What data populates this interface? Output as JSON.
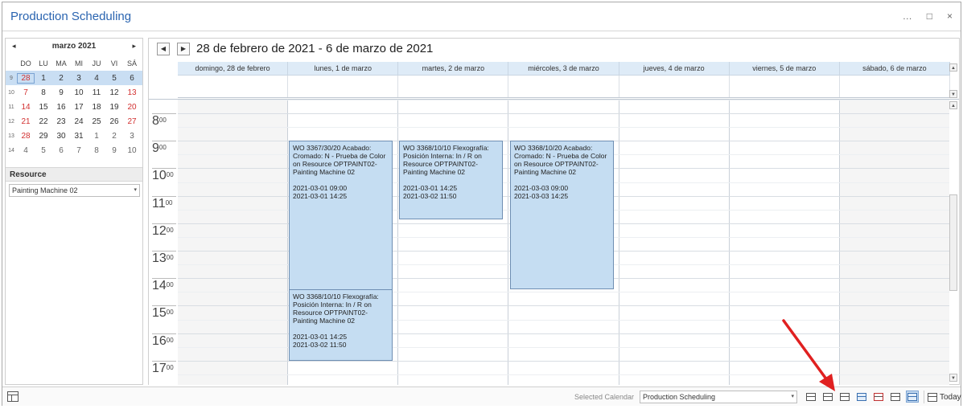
{
  "window": {
    "title": "Production Scheduling",
    "buttons": [
      "…",
      "□",
      "×"
    ]
  },
  "mini_calendar": {
    "month_label": "marzo 2021",
    "prev_icon": "◂",
    "next_icon": "▸",
    "dow": [
      "DO",
      "LU",
      "MA",
      "MI",
      "JU",
      "VI",
      "SÁ"
    ],
    "weeks": [
      {
        "wk": "9",
        "days": [
          "28",
          "1",
          "2",
          "3",
          "4",
          "5",
          "6"
        ]
      },
      {
        "wk": "10",
        "days": [
          "7",
          "8",
          "9",
          "10",
          "11",
          "12",
          "13"
        ]
      },
      {
        "wk": "11",
        "days": [
          "14",
          "15",
          "16",
          "17",
          "18",
          "19",
          "20"
        ]
      },
      {
        "wk": "12",
        "days": [
          "21",
          "22",
          "23",
          "24",
          "25",
          "26",
          "27"
        ]
      },
      {
        "wk": "13",
        "days": [
          "28",
          "29",
          "30",
          "31",
          "1",
          "2",
          "3"
        ]
      },
      {
        "wk": "14",
        "days": [
          "4",
          "5",
          "6",
          "7",
          "8",
          "9",
          "10"
        ]
      }
    ]
  },
  "resource": {
    "label": "Resource",
    "value": "Painting Machine 02"
  },
  "scheduler": {
    "range_title": "28 de febrero de 2021 - 6 de marzo de 2021",
    "prev_icon": "◀",
    "next_icon": "▶",
    "days": [
      "domingo, 28 de febrero",
      "lunes, 1 de marzo",
      "martes, 2 de marzo",
      "miércoles, 3 de marzo",
      "jueves, 4 de marzo",
      "viernes, 5 de marzo",
      "sábado, 6 de marzo"
    ],
    "hours": [
      {
        "h": "8",
        "m": "00"
      },
      {
        "h": "9",
        "m": "00"
      },
      {
        "h": "10",
        "m": "00"
      },
      {
        "h": "11",
        "m": "00"
      },
      {
        "h": "12",
        "m": "00"
      },
      {
        "h": "13",
        "m": "00"
      },
      {
        "h": "14",
        "m": "00"
      },
      {
        "h": "15",
        "m": "00"
      },
      {
        "h": "16",
        "m": "00"
      },
      {
        "h": "17",
        "m": "00"
      }
    ],
    "appointments": [
      {
        "title": "WO 3367/30/20 Acabado: Cromado: N - Prueba de Color on Resource OPTPAINT02-Painting Machine 02",
        "start": "2021-03-01 09:00",
        "end": "2021-03-01 14:25"
      },
      {
        "title": "WO 3368/10/10 Flexografía: Posición Interna: In / R on Resource OPTPAINT02-Painting Machine 02",
        "start": "2021-03-01 14:25",
        "end": "2021-03-02 11:50"
      },
      {
        "title": "WO 3368/10/10 Flexografía: Posición Interna: In / R on Resource OPTPAINT02-Painting Machine 02",
        "start": "2021-03-01 14:25",
        "end": "2021-03-02 11:50"
      },
      {
        "title": "WO 3368/10/20 Acabado: Cromado: N - Prueba de Color on Resource OPTPAINT02-Painting Machine 02",
        "start": "2021-03-03 09:00",
        "end": "2021-03-03 14:25"
      }
    ]
  },
  "statusbar": {
    "selected_calendar_label": "Selected Calendar",
    "selected_calendar_value": "Production Scheduling",
    "today_label": "Today"
  },
  "colors": {
    "accent": "#2a64b0",
    "appointment": "#c5ddf2",
    "header": "#deebf7",
    "annotation_arrow": "#e02020"
  }
}
